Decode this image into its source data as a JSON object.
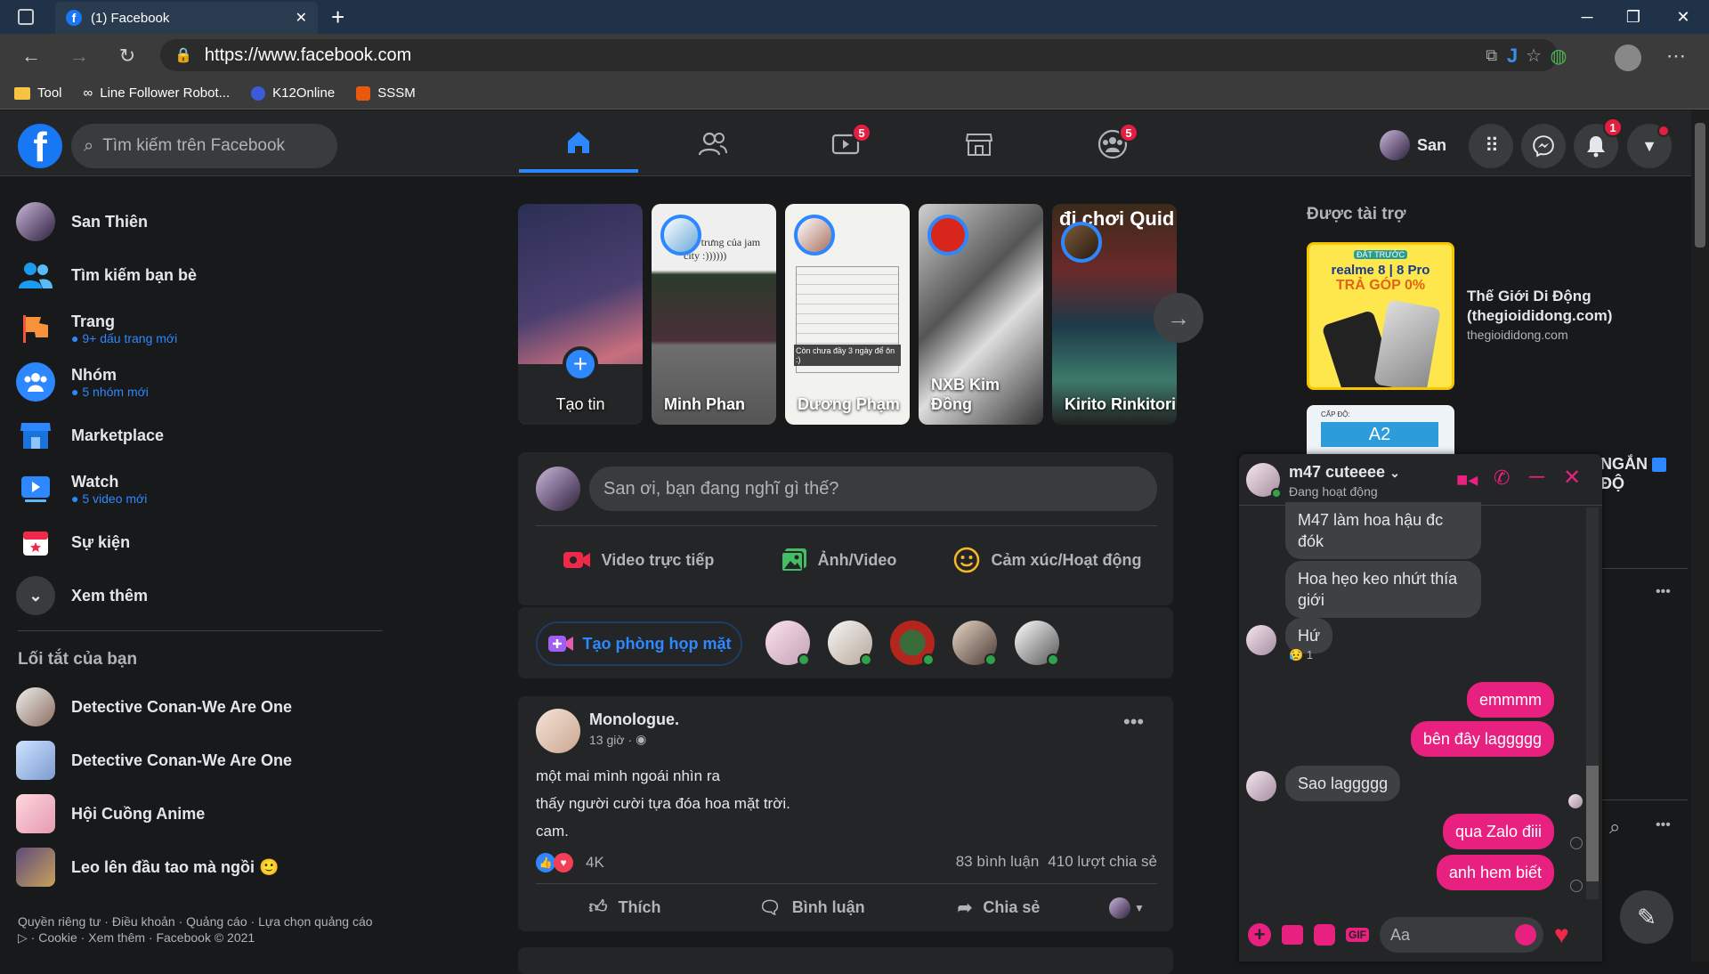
{
  "browser": {
    "tab_title": "(1) Facebook",
    "url": "https://www.facebook.com",
    "bookmarks": [
      "Tool",
      "Line Follower Robot...",
      "K12Online",
      "SSSM"
    ]
  },
  "header": {
    "search_placeholder": "Tìm kiếm trên Facebook",
    "watch_badge": "5",
    "groups_badge": "5",
    "user_name": "San",
    "notifications_badge": "1"
  },
  "sidebar": {
    "items": [
      {
        "label": "San Thiên",
        "sub": ""
      },
      {
        "label": "Tìm kiếm bạn bè",
        "sub": ""
      },
      {
        "label": "Trang",
        "sub": "9+ dấu trang mới"
      },
      {
        "label": "Nhóm",
        "sub": "5 nhóm mới"
      },
      {
        "label": "Marketplace",
        "sub": ""
      },
      {
        "label": "Watch",
        "sub": "5 video mới"
      },
      {
        "label": "Sự kiện",
        "sub": ""
      },
      {
        "label": "Xem thêm",
        "sub": ""
      }
    ],
    "shortcuts_title": "Lối tắt của bạn",
    "shortcuts": [
      "Detective Conan-We Are One",
      "Detective Conan-We Are One",
      "Hội Cuồng Anime",
      "Leo lên đầu tao mà ngồi 🙂"
    ],
    "footer": "Quyền riêng tư · Điều khoản · Quảng cáo · Lựa chọn quảng cáo ▷ · Cookie · Xem thêm · Facebook © 2021"
  },
  "stories": [
    {
      "name": "Tạo tin",
      "text": ""
    },
    {
      "name": "Minh Phan",
      "text": "đặc trưng của jam city :))))))"
    },
    {
      "name": "Dương Phạm",
      "text": "Còn chưa đầy 3 ngày để ôn :)"
    },
    {
      "name": "NXB Kim Đồng",
      "text": ""
    },
    {
      "name": "Kirito Rinkitori",
      "text": "đi chơi Quid"
    }
  ],
  "composer": {
    "placeholder": "San ơi, bạn đang nghĩ gì thế?",
    "live": "Video trực tiếp",
    "photo": "Ảnh/Video",
    "feeling": "Cảm xúc/Hoạt động"
  },
  "rooms": {
    "button": "Tạo phòng họp mặt"
  },
  "post": {
    "author": "Monologue.",
    "time": "13 giờ ·",
    "lines": [
      "một mai mình ngoái nhìn ra",
      "thấy người cười tựa đóa hoa mặt trời.",
      "cam."
    ],
    "reactions": "4K",
    "comments": "83 bình luận",
    "shares": "410 lượt chia sẻ",
    "like": "Thích",
    "comment": "Bình luận",
    "share": "Chia sẻ"
  },
  "sponsored": {
    "title": "Được tài trợ",
    "ad_name": "Thế Giới Di Động (thegioididong.com)",
    "ad_url": "thegioididong.com",
    "ad_image_top": "ĐẶT TRƯỚC",
    "ad_image_line1": "realme 8 | 8 Pro",
    "ad_image_line2": "TRẢ GÓP 0%",
    "ad2_label": "CẤP ĐỘ:",
    "ad2_value": "A2",
    "partial_text": "NGẮN ĐỘ"
  },
  "chat": {
    "name": "m47 cuteeee",
    "status": "Đang hoạt động",
    "messages": [
      {
        "dir": "in",
        "text": "M47 làm hoa hậu đc đók"
      },
      {
        "dir": "in",
        "text": "Hoa hẹo keo nhứt thía giới"
      },
      {
        "dir": "in",
        "text": "Hứ",
        "reaction": "😥",
        "reaction_count": "1"
      },
      {
        "dir": "out",
        "text": "emmmm"
      },
      {
        "dir": "out",
        "text": "bên đây laggggg"
      },
      {
        "dir": "in",
        "text": "Sao laggggg"
      },
      {
        "dir": "out",
        "text": "qua Zalo điii"
      },
      {
        "dir": "out",
        "text": "anh hem biết"
      }
    ],
    "input_placeholder": "Aa"
  }
}
